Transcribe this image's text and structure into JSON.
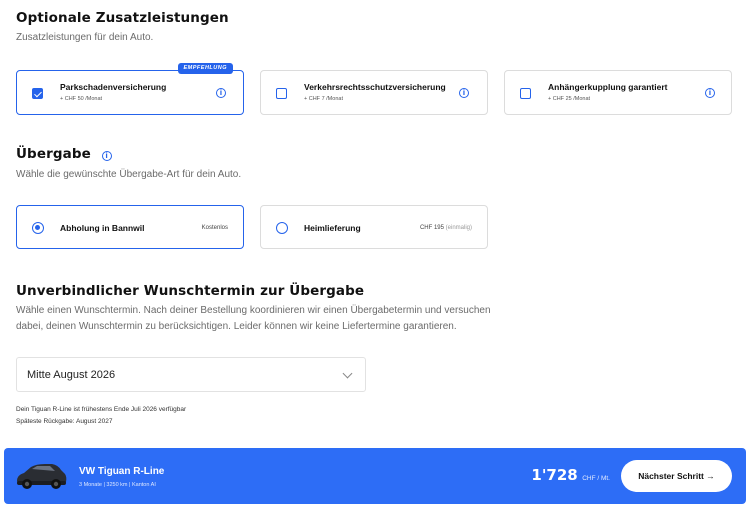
{
  "addons": {
    "title": "Optionale Zusatzleistungen",
    "subtitle": "Zusatzleistungen für dein Auto.",
    "items": [
      {
        "title": "Parkschadenversicherung",
        "price": "+ CHF 50 /Monat",
        "checked": true,
        "badge": "EMPFEHLUNG"
      },
      {
        "title": "Verkehrsrechtsschutzversicherung",
        "price": "+ CHF 7 /Monat",
        "checked": false
      },
      {
        "title": "Anhängerkupplung garantiert",
        "price": "+ CHF 25 /Monat",
        "checked": false
      }
    ]
  },
  "handover": {
    "title": "Übergabe",
    "subtitle": "Wähle die gewünschte Übergabe-Art für dein Auto.",
    "options": [
      {
        "title": "Abholung in Bannwil",
        "price": "Kostenlos",
        "selected": true
      },
      {
        "title": "Heimlieferung",
        "price": "CHF 195",
        "price_note": "(einmalig)",
        "selected": false
      }
    ]
  },
  "date": {
    "title": "Unverbindlicher Wunschtermin zur Übergabe",
    "desc_line1": "Wähle einen Wunschtermin. Nach deiner Bestellung koordinieren wir einen Übergabetermin und versuchen",
    "desc_line2": "dabei, deinen Wunschtermin zu berücksichtigen. Leider können wir keine Liefertermine garantieren.",
    "selected": "Mitte August 2026",
    "note1": "Dein Tiguan R-Line ist frühestens Ende Juli 2026 verfügbar",
    "note2": "Späteste Rückgabe: August 2027"
  },
  "footer": {
    "car_name": "VW Tiguan R-Line",
    "car_meta": "3 Monate | 3250 km | Kanton AI",
    "price": "1'728",
    "unit": "CHF / Mt.",
    "next_label": "Nächster Schritt",
    "next_arrow": "→"
  },
  "info_glyph": "i",
  "colors": {
    "accent": "#2563eb",
    "bar": "#2d6df6"
  }
}
